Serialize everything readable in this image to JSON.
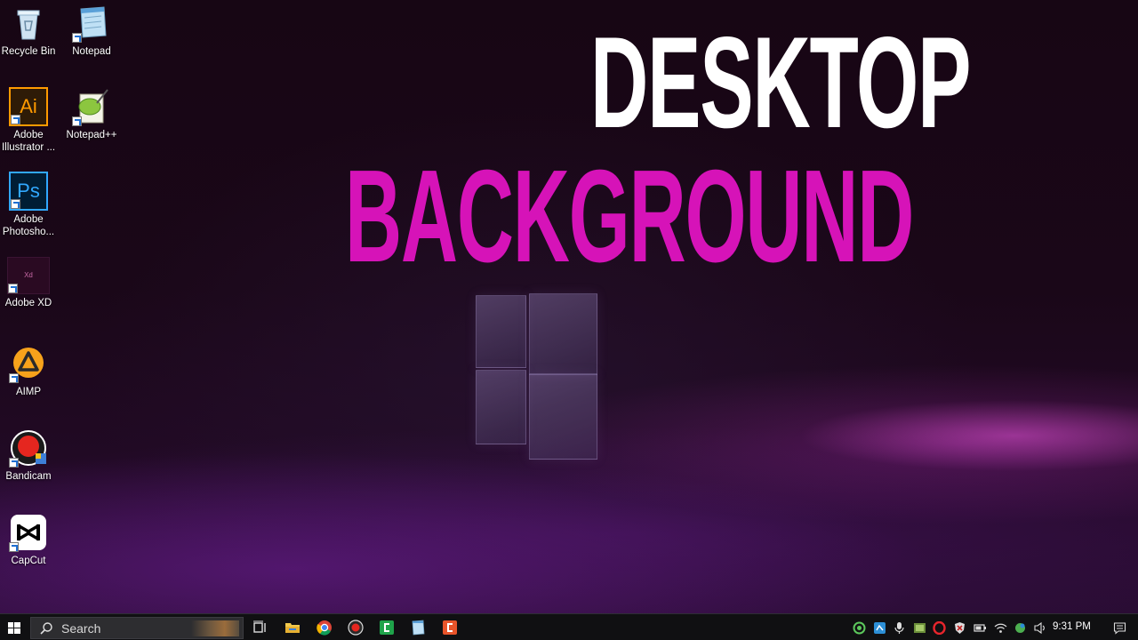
{
  "headline": {
    "line1": "DESKTOP",
    "line2": "BACKGROUND",
    "line1_color": "#ffffff",
    "line2_color": "#d613b8"
  },
  "desktop_icons": [
    {
      "label": "Recycle Bin",
      "icon": "recycle-bin-icon"
    },
    {
      "label": "Notepad",
      "icon": "notepad-icon"
    },
    {
      "label_line1": "Adobe",
      "label_line2": "Illustrator ...",
      "icon": "adobe-illustrator-icon",
      "glyph": "Ai"
    },
    {
      "label": "Notepad++",
      "icon": "notepad-plus-plus-icon"
    },
    {
      "label_line1": "Adobe",
      "label_line2": "Photosho...",
      "icon": "adobe-photoshop-icon",
      "glyph": "Ps"
    },
    {
      "label": "Adobe XD",
      "icon": "adobe-xd-icon",
      "glyph": "Xd"
    },
    {
      "label": "AIMP",
      "icon": "aimp-icon"
    },
    {
      "label": "Bandicam",
      "icon": "bandicam-icon"
    },
    {
      "label": "CapCut",
      "icon": "capcut-icon"
    }
  ],
  "taskbar": {
    "search_placeholder": "Search",
    "pinned": [
      "task-view-icon",
      "file-explorer-icon",
      "chrome-icon",
      "record-icon",
      "camtasia-icon",
      "notepad-icon",
      "capcut-orange-icon"
    ],
    "tray": [
      "green-circle-icon",
      "network-app-icon",
      "microphone-icon",
      "app-icon",
      "opera-icon",
      "security-icon",
      "battery-icon",
      "wifi-icon",
      "update-icon",
      "volume-icon"
    ],
    "clock": "9:31 PM"
  },
  "colors": {
    "accent_magenta": "#d613b8",
    "taskbar_bg": "#101012"
  }
}
